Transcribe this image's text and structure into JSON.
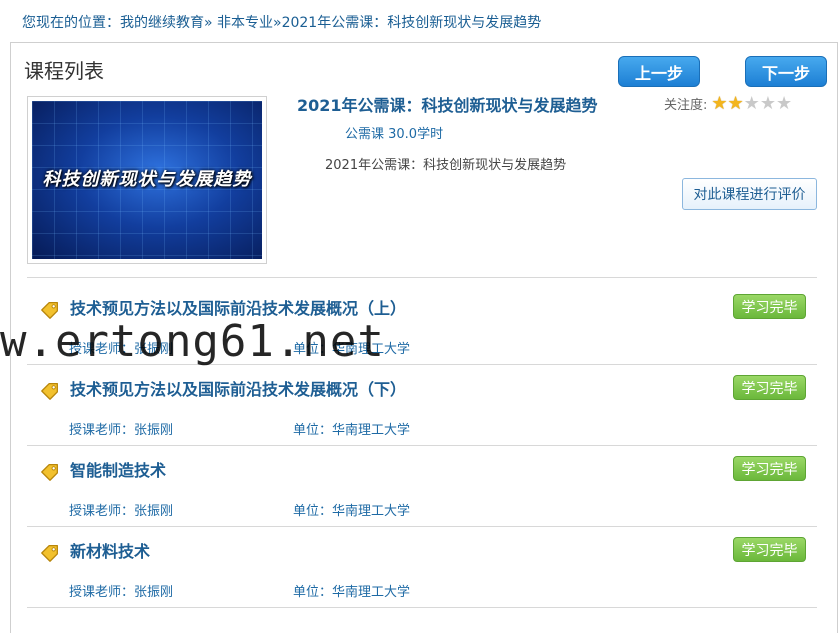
{
  "breadcrumb": "您现在的位置：我的继续教育» 非本专业»2021年公需课：科技创新现状与发展趋势",
  "panel": {
    "title": "课程列表",
    "prev_label": "上一步",
    "next_label": "下一步"
  },
  "course": {
    "thumbnail_text": "科技创新现状与发展趋势",
    "title": "2021年公需课：科技创新现状与发展趋势",
    "meta": "公需课 30.0学时",
    "description": "2021年公需课：科技创新现状与发展趋势",
    "attention_label": "关注度:",
    "rating": 2,
    "rating_max": 5,
    "evaluate_label": "对此课程进行评价"
  },
  "chapters": [
    {
      "title": "技术预见方法以及国际前沿技术发展概况（上）",
      "teacher": "授课老师：张振刚",
      "unit": "单位：华南理工大学",
      "status": "学习完毕"
    },
    {
      "title": "技术预见方法以及国际前沿技术发展概况（下）",
      "teacher": "授课老师：张振刚",
      "unit": "单位：华南理工大学",
      "status": "学习完毕"
    },
    {
      "title": "智能制造技术",
      "teacher": "授课老师：张振刚",
      "unit": "单位：华南理工大学",
      "status": "学习完毕"
    },
    {
      "title": "新材料技术",
      "teacher": "授课老师：张振刚",
      "unit": "单位：华南理工大学",
      "status": "学习完毕"
    }
  ],
  "watermark": "w.ertong61.net",
  "colors": {
    "link": "#1e5e93",
    "primary_button": "#1d7fd4",
    "done_button": "#6bb83b",
    "star_on": "#f3b51d",
    "star_off": "#c9c9c9"
  }
}
